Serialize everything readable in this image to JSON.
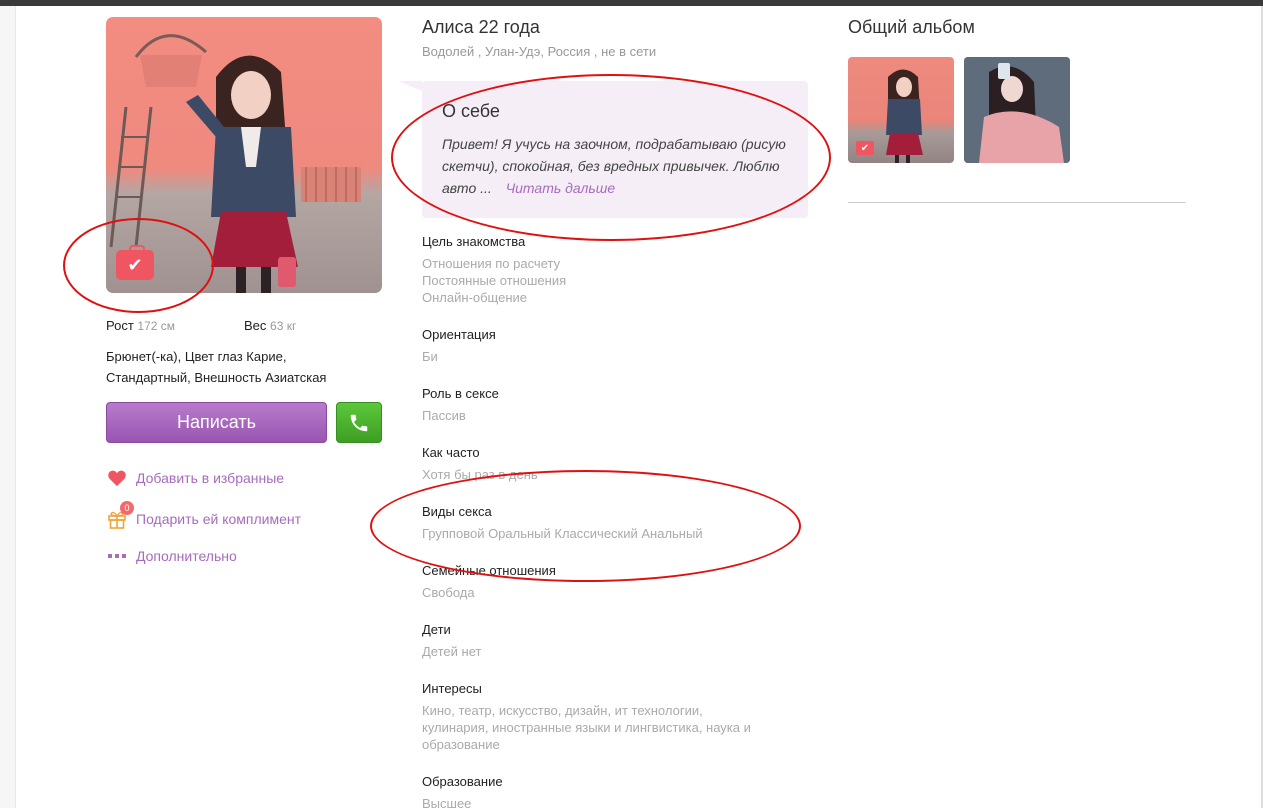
{
  "profile": {
    "name": "Алиса 22 года",
    "subinfo": "Водолей , Улан-Удэ, Россия , не в сети",
    "height_label": "Рост",
    "height_value": "172 см",
    "weight_label": "Вес",
    "weight_value": "63 кг",
    "description": "Брюнет(-ка), Цвет глаз Карие, Стандартный, Внешность Азиатская"
  },
  "actions": {
    "write_label": "Написать",
    "favorite_label": "Добавить в избранные",
    "compliment_label": "Подарить ей комплимент",
    "compliment_count": "0",
    "more_label": "Дополнительно"
  },
  "about": {
    "title": "О себе",
    "text": "Привет! Я учусь на заочном, подрабатываю (рисую скетчи), спокойная, без вредных привычек. Люблю авто ...",
    "more_label": "Читать дальше"
  },
  "fields": [
    {
      "title": "Цель знакомства",
      "lines": [
        "Отношения по расчету",
        "Постоянные отношения",
        "Онлайн-общение"
      ]
    },
    {
      "title": "Ориентация",
      "lines": [
        "Би"
      ]
    },
    {
      "title": "Роль в сексе",
      "lines": [
        "Пассив"
      ]
    },
    {
      "title": "Как часто",
      "lines": [
        "Хотя бы раз в день"
      ]
    },
    {
      "title": "Виды секса",
      "lines": [
        "Групповой Оральный Классический Анальный"
      ]
    },
    {
      "title": "Семейные отношения",
      "lines": [
        "Свобода"
      ]
    },
    {
      "title": "Дети",
      "lines": [
        "Детей нет"
      ]
    },
    {
      "title": "Интересы",
      "lines": [
        "Кино, театр, искусство, дизайн, ит технологии,",
        "кулинария, иностранные языки и лингвистика, наука и",
        "образование"
      ]
    },
    {
      "title": "Образование",
      "lines": [
        "Высшее"
      ]
    }
  ],
  "album": {
    "title": "Общий альбом"
  },
  "colors": {
    "accent": "#a66cbd",
    "write_button": "#9a55b2",
    "call_button": "#4cb02d",
    "verified_badge": "#f05661",
    "annotation": "#e01010"
  },
  "icons": [
    "verified-icon",
    "phone-icon",
    "heart-icon",
    "gift-icon",
    "more-dots-icon",
    "check-icon"
  ]
}
